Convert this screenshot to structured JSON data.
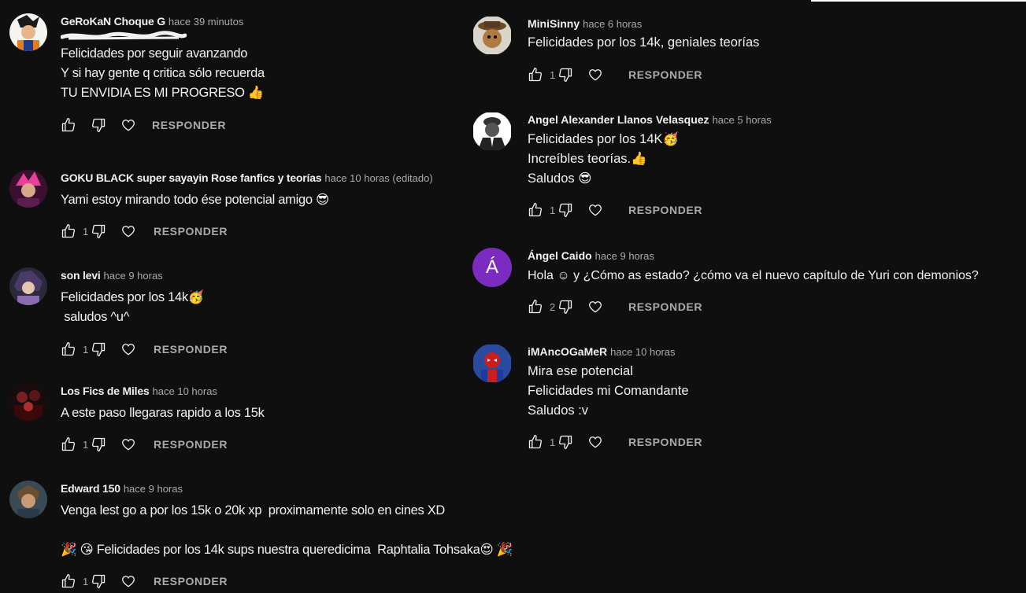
{
  "reply_label": "RESPONDER",
  "colors": {
    "background": "#0f0f0f",
    "text": "#f1f1f1",
    "muted": "#aaaaaa",
    "purple_avatar": "#7b2bbf"
  },
  "left_column": [
    {
      "author": "GeRoKaN Choque G",
      "time": "hace 39 minutos",
      "lines": [
        "Felicidades por seguir avanzando",
        "Y si hay gente q critica sólo recuerda",
        "TU ENVIDIA ES MI PROGRESO 👍"
      ],
      "likes": ""
    },
    {
      "author": "GOKU BLACK super sayayin Rose fanfics y teorías",
      "time": "hace 10 horas (editado)",
      "lines": [
        "Yami estoy mirando todo ése potencial amigo 😎"
      ],
      "likes": "1"
    },
    {
      "author": "son levi",
      "time": "hace 9 horas",
      "lines": [
        "Felicidades por los 14k🥳",
        " saludos ^u^"
      ],
      "likes": "1"
    },
    {
      "author": "Los Fics de Miles",
      "time": "hace 10 horas",
      "lines": [
        "A este paso llegaras rapido a los 15k"
      ],
      "likes": "1"
    },
    {
      "author": "Edward 150",
      "time": "hace 9 horas",
      "lines": [
        "Venga lest go a por los 15k o 20k xp  proximamente solo en cines XD",
        "",
        "🎉 😘 Felicidades por los 14k sups nuestra queredicima  Raphtalia Tohsaka😍 🎉"
      ],
      "likes": "1"
    }
  ],
  "right_column": [
    {
      "author": "MiniSinny",
      "time": "hace 6 horas",
      "lines": [
        "Felicidades por los 14k, geniales teorías"
      ],
      "likes": "1"
    },
    {
      "author": "Angel Alexander Llanos Velasquez",
      "time": "hace 5 horas",
      "lines": [
        "Felicidades por los 14K🥳",
        "Increíbles teorías.👍",
        "Saludos 😎"
      ],
      "likes": "1"
    },
    {
      "author": "Ángel Caido",
      "time": "hace 9 horas",
      "avatar_letter": "Á",
      "lines": [
        "Hola ☺ y ¿Cómo as estado? ¿cómo va el nuevo capítulo de Yuri con demonios?"
      ],
      "likes": "2"
    },
    {
      "author": "iMAncOGaMeR",
      "time": "hace 10 horas",
      "lines": [
        "Mira ese potencial",
        "Felicidades mi Comandante",
        "Saludos :v"
      ],
      "likes": "1"
    }
  ]
}
